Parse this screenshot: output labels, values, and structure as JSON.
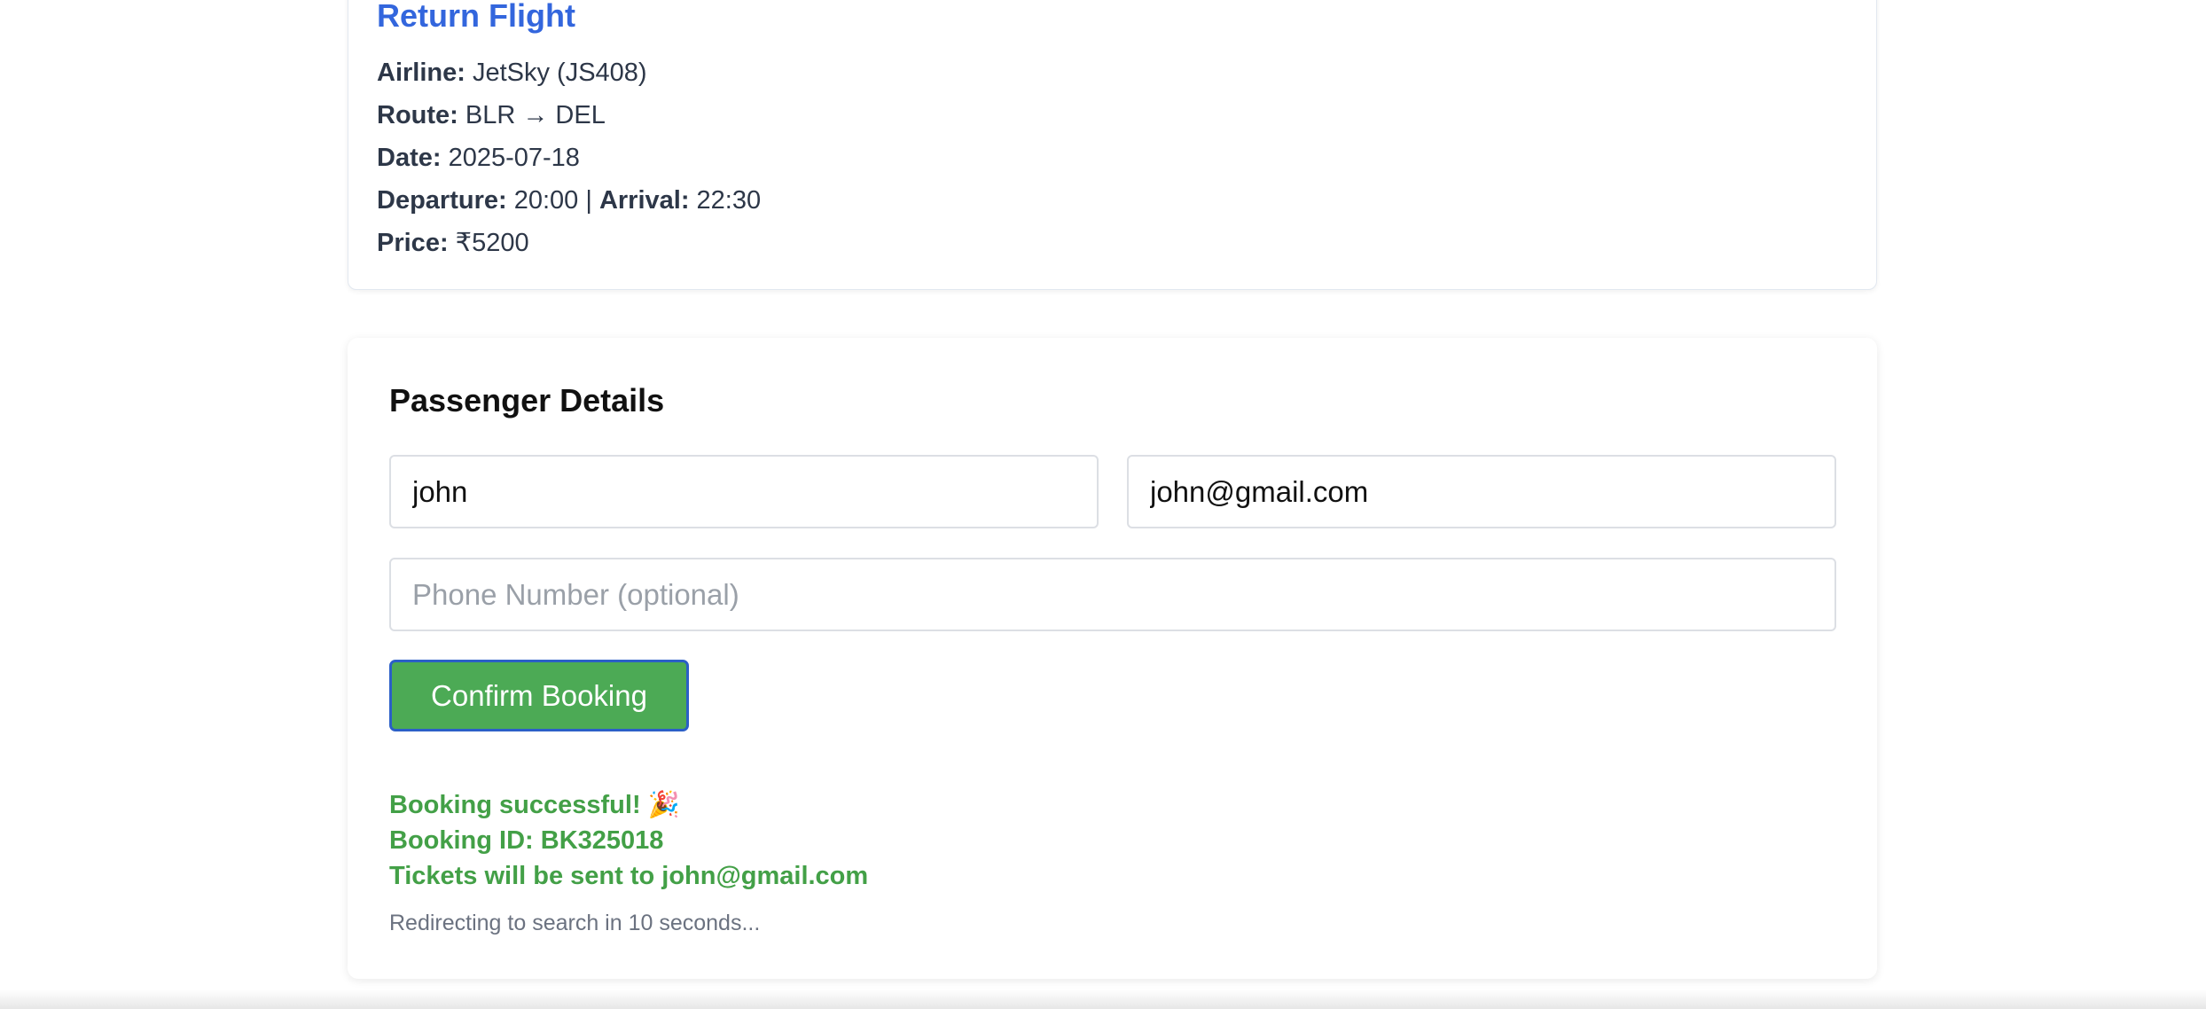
{
  "return_flight": {
    "title": "Return Flight",
    "airline_label": "Airline:",
    "airline_value": " JetSky (JS408)",
    "route_label": "Route:",
    "route_value": " BLR → DEL",
    "date_label": "Date:",
    "date_value": " 2025-07-18",
    "departure_label": "Departure:",
    "departure_value": " 20:00 | ",
    "arrival_label": "Arrival:",
    "arrival_value": " 22:30",
    "price_label": "Price:",
    "price_value": " ₹5200"
  },
  "passenger": {
    "title": "Passenger Details",
    "name_value": "john",
    "email_value": "john@gmail.com",
    "phone_placeholder": "Phone Number (optional)",
    "phone_value": "",
    "confirm_label": "Confirm Booking"
  },
  "result": {
    "success": "Booking successful! 🎉",
    "booking_id": "Booking ID: BK325018",
    "tickets": "Tickets will be sent to john@gmail.com",
    "redirect": "Redirecting to search in 10 seconds..."
  },
  "colors": {
    "accent_blue": "#3366dd",
    "success_green": "#43a047",
    "button_green": "#4caa55"
  }
}
